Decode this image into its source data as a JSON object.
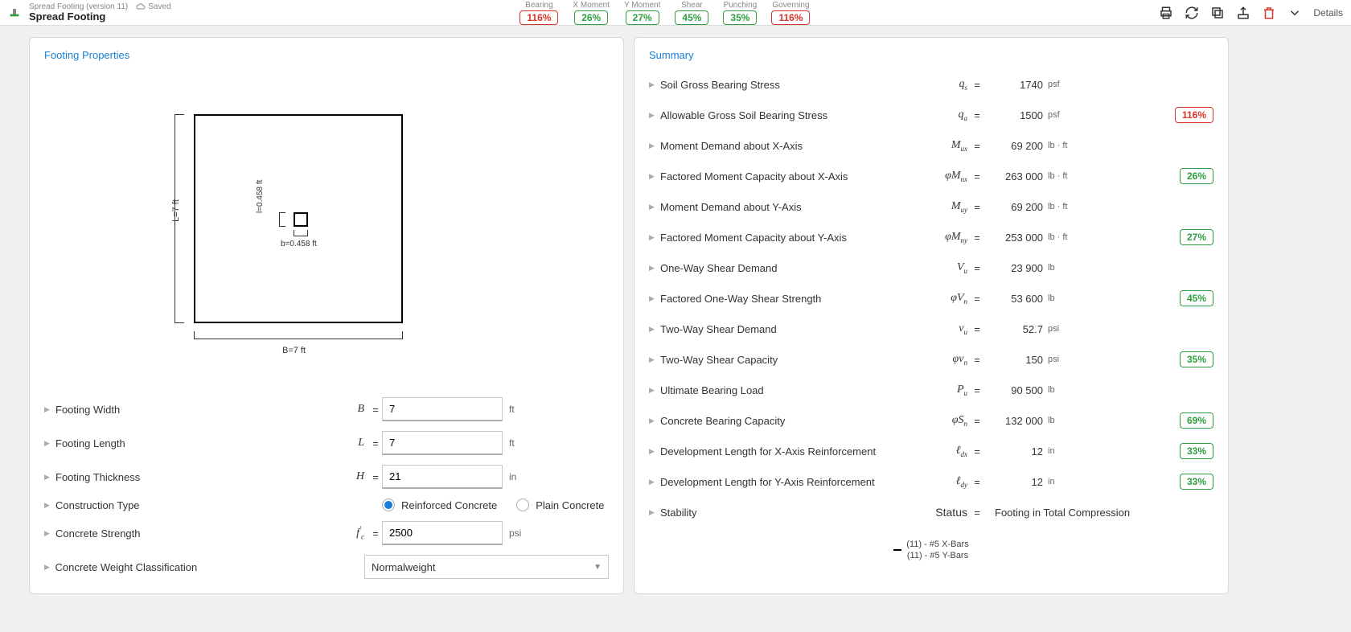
{
  "topbar": {
    "doc_version": "Spread Footing (version 11)",
    "saved": "Saved",
    "title": "Spread Footing",
    "details": "Details",
    "status": [
      {
        "label": "Bearing",
        "value": "116%",
        "cls": "badge-red"
      },
      {
        "label": "X Moment",
        "value": "26%",
        "cls": "badge-green"
      },
      {
        "label": "Y Moment",
        "value": "27%",
        "cls": "badge-green"
      },
      {
        "label": "Shear",
        "value": "45%",
        "cls": "badge-green"
      },
      {
        "label": "Punching",
        "value": "35%",
        "cls": "badge-green"
      },
      {
        "label": "Governing",
        "value": "116%",
        "cls": "badge-red"
      }
    ]
  },
  "left_panel": {
    "title": "Footing Properties",
    "diagram": {
      "L_label": "L=7 ft",
      "B_label": "B=7 ft",
      "l_label": "l=0.458 ft",
      "b_label": "b=0.458 ft"
    },
    "rows": {
      "width": {
        "label": "Footing Width",
        "sym_html": "B",
        "value": "7",
        "unit": "ft"
      },
      "length": {
        "label": "Footing Length",
        "sym_html": "L",
        "value": "7",
        "unit": "ft"
      },
      "thickness": {
        "label": "Footing Thickness",
        "sym_html": "H",
        "value": "21",
        "unit": "in"
      },
      "ctype": {
        "label": "Construction Type",
        "opt1": "Reinforced Concrete",
        "opt2": "Plain Concrete"
      },
      "strength": {
        "label": "Concrete Strength",
        "value": "2500",
        "unit": "psi"
      },
      "weightcls": {
        "label": "Concrete Weight Classification",
        "value": "Normalweight"
      }
    }
  },
  "right_panel": {
    "title": "Summary",
    "rows": [
      {
        "label": "Soil Gross Bearing Stress",
        "sym": "q",
        "sub": "s",
        "value": "1740",
        "unit": "psf",
        "badge": "",
        "cls": ""
      },
      {
        "label": "Allowable Gross Soil Bearing Stress",
        "sym": "q",
        "sub": "a",
        "value": "1500",
        "unit": "psf",
        "badge": "116%",
        "cls": "badge-red"
      },
      {
        "label": "Moment Demand about X-Axis",
        "sym": "M",
        "sub": "ux",
        "value": "69 200",
        "unit": "lb · ft",
        "badge": "",
        "cls": ""
      },
      {
        "label": "Factored Moment Capacity about X-Axis",
        "sym": "φM",
        "sub": "nx",
        "value": "263 000",
        "unit": "lb · ft",
        "badge": "26%",
        "cls": "badge-green"
      },
      {
        "label": "Moment Demand about Y-Axis",
        "sym": "M",
        "sub": "uy",
        "value": "69 200",
        "unit": "lb · ft",
        "badge": "",
        "cls": ""
      },
      {
        "label": "Factored Moment Capacity about Y-Axis",
        "sym": "φM",
        "sub": "ny",
        "value": "253 000",
        "unit": "lb · ft",
        "badge": "27%",
        "cls": "badge-green"
      },
      {
        "label": "One-Way Shear Demand",
        "sym": "V",
        "sub": "u",
        "value": "23 900",
        "unit": "lb",
        "badge": "",
        "cls": ""
      },
      {
        "label": "Factored One-Way Shear Strength",
        "sym": "φV",
        "sub": "n",
        "value": "53 600",
        "unit": "lb",
        "badge": "45%",
        "cls": "badge-green"
      },
      {
        "label": "Two-Way Shear Demand",
        "sym": "v",
        "sub": "u",
        "value": "52.7",
        "unit": "psi",
        "badge": "",
        "cls": ""
      },
      {
        "label": "Two-Way Shear Capacity",
        "sym": "φv",
        "sub": "n",
        "value": "150",
        "unit": "psi",
        "badge": "35%",
        "cls": "badge-green"
      },
      {
        "label": "Ultimate Bearing Load",
        "sym": "P",
        "sub": "u",
        "value": "90 500",
        "unit": "lb",
        "badge": "",
        "cls": ""
      },
      {
        "label": "Concrete Bearing Capacity",
        "sym": "φS",
        "sub": "n",
        "value": "132 000",
        "unit": "lb",
        "badge": "69%",
        "cls": "badge-green"
      },
      {
        "label": "Development Length for X-Axis Reinforcement",
        "sym": "ℓ",
        "sub": "dx",
        "value": "12",
        "unit": "in",
        "badge": "33%",
        "cls": "badge-green"
      },
      {
        "label": "Development Length for Y-Axis Reinforcement",
        "sym": "ℓ",
        "sub": "dy",
        "value": "12",
        "unit": "in",
        "badge": "33%",
        "cls": "badge-green"
      },
      {
        "label": "Stability",
        "sym": "Status",
        "sub": "",
        "value": "Footing in Total Compression",
        "unit": "",
        "badge": "",
        "cls": "",
        "wide": true
      }
    ],
    "rebar_x": "(11) - #5 X-Bars",
    "rebar_y": "(11) - #5 Y-Bars"
  }
}
